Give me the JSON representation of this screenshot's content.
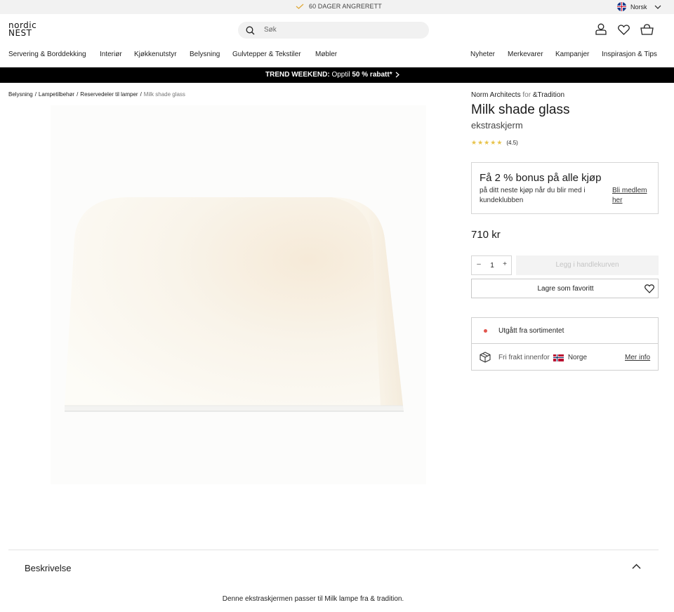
{
  "topbar": {
    "promise": "60 DAGER ANGRERETT",
    "language": "Norsk"
  },
  "header": {
    "logo_line1": "nordic",
    "logo_line2": "NEST",
    "search_placeholder": "Søk",
    "icons": [
      "search-icon",
      "account-icon",
      "wishlist-icon",
      "cart-icon"
    ]
  },
  "nav": {
    "left": [
      "Servering & Borddekking",
      "Interiør",
      "Kjøkkenutstyr",
      "Belysning",
      "Gulvtepper & Tekstiler",
      "Møbler"
    ],
    "right": [
      "Nyheter",
      "Merkevarer",
      "Kampanjer",
      "Inspirasjon & Tips"
    ]
  },
  "banner": {
    "bold1": "TREND WEEKEND:",
    "text": " Opptil ",
    "bold2": "50 % rabatt*"
  },
  "breadcrumb": [
    "Belysning",
    "Lampetilbehør",
    "Reservedeler til lamper",
    "Milk shade glass"
  ],
  "product": {
    "designer": "Norm Architects",
    "for_word": "for",
    "brand": "&Tradition",
    "title": "Milk shade glass",
    "subtitle": "ekstraskjerm",
    "rating_value": 4.5,
    "rating_text": "(4.5)",
    "price": "710 kr",
    "quantity": "1",
    "add_to_cart": "Legg i handlekurven",
    "save_favorite": "Lagre som favoritt"
  },
  "bonus": {
    "heading": "Få 2 % bonus på alle kjøp",
    "text": "på ditt neste kjøp når du blir med i kundeklubben",
    "link": "Bli medlem her"
  },
  "info": {
    "status": "Utgått fra sortimentet",
    "shipping": "Fri frakt innenfor",
    "country": "Norge",
    "more": "Mer info"
  },
  "description": {
    "heading": "Beskrivelse",
    "text": "Denne ekstraskjermen passer til Milk lampe fra & tradition."
  },
  "colors": {
    "banner_bg": "#000000",
    "star": "#e8c34a",
    "status_dot": "#e2564e"
  }
}
